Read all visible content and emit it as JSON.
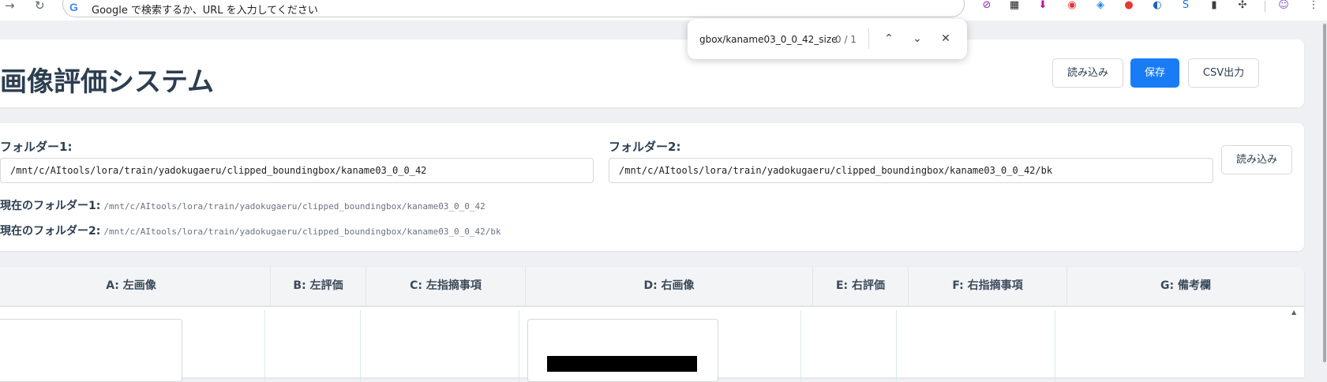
{
  "browser": {
    "omnibox_placeholder": "Google で検索するか、URL を入力してください",
    "google_logo": "G"
  },
  "findbar": {
    "query": "gbox/kaname03_0_0_42_size",
    "count": "0 / 1"
  },
  "header": {
    "title": "画像評価システム",
    "load_label": "読み込み",
    "save_label": "保存",
    "csv_label": "CSV出力"
  },
  "folders": {
    "folder1_label": "フォルダー1:",
    "folder1_value": "/mnt/c/AItools/lora/train/yadokugaeru/clipped_boundingbox/kaname03_0_0_42",
    "folder2_label": "フォルダー2:",
    "folder2_value": "/mnt/c/AItools/lora/train/yadokugaeru/clipped_boundingbox/kaname03_0_0_42/bk",
    "load_label": "読み込み",
    "current1_label": "現在のフォルダー1:",
    "current1_value": "/mnt/c/AItools/lora/train/yadokugaeru/clipped_boundingbox/kaname03_0_0_42",
    "current2_label": "現在のフォルダー2:",
    "current2_value": "/mnt/c/AItools/lora/train/yadokugaeru/clipped_boundingbox/kaname03_0_0_42/bk"
  },
  "table": {
    "columns": [
      "A: 左画像",
      "B: 左評価",
      "C: 左指摘事項",
      "D: 右画像",
      "E: 右評価",
      "F: 右指摘事項",
      "G: 備考欄"
    ]
  }
}
